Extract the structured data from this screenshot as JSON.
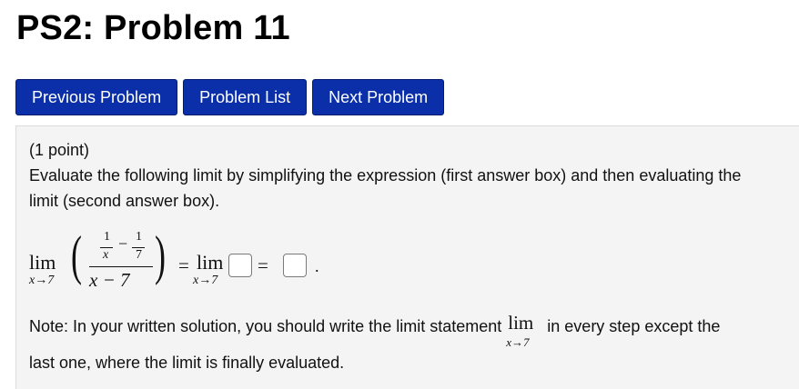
{
  "page": {
    "title": "PS2: Problem 11"
  },
  "nav": {
    "prev_label": "Previous Problem",
    "list_label": "Problem List",
    "next_label": "Next Problem"
  },
  "problem": {
    "points": "(1 point)",
    "instruction": "Evaluate the following limit by simplifying the expression (first answer box) and then evaluating the limit (second answer box).",
    "math": {
      "lim": "lim",
      "sub": "x→7",
      "inner_num_1": "1",
      "inner_den_1": "x",
      "inner_num_2": "1",
      "inner_den_2": "7",
      "minus": "−",
      "outer_den": "x − 7",
      "equals": "=",
      "period": "."
    },
    "answer1": {
      "value": ""
    },
    "answer2": {
      "value": ""
    },
    "note_part1": "Note: In your written solution, you should write the limit statement",
    "note_part2": "in every step except the",
    "note_line2": "last one, where the limit is finally evaluated."
  }
}
